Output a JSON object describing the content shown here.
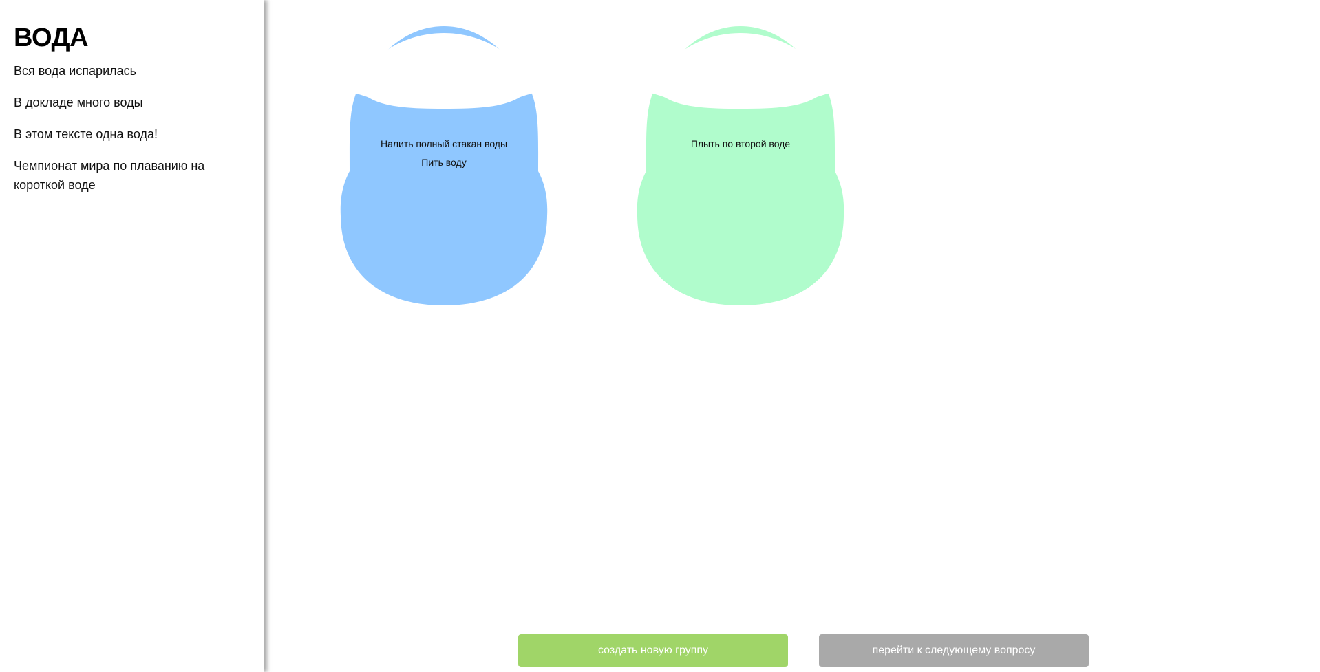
{
  "sidebar": {
    "title": "ВОДА",
    "items": [
      {
        "label": "Вся вода испарилась"
      },
      {
        "label": "В докладе много воды"
      },
      {
        "label": "В этом тексте одна вода!"
      },
      {
        "label": "Чемпионат мира по плаванию на короткой воде"
      }
    ]
  },
  "groups": [
    {
      "color": "#8fc7ff",
      "items": [
        {
          "label": "Налить полный стакан воды"
        },
        {
          "label": "Пить воду"
        }
      ]
    },
    {
      "color": "#b0fccc",
      "items": [
        {
          "label": "Плыть по второй воде"
        }
      ]
    }
  ],
  "buttons": {
    "create_label": "создать новую группу",
    "create_color": "#a0d568",
    "next_label": "перейти к следующему вопросу",
    "next_color": "#a9a9a9"
  }
}
